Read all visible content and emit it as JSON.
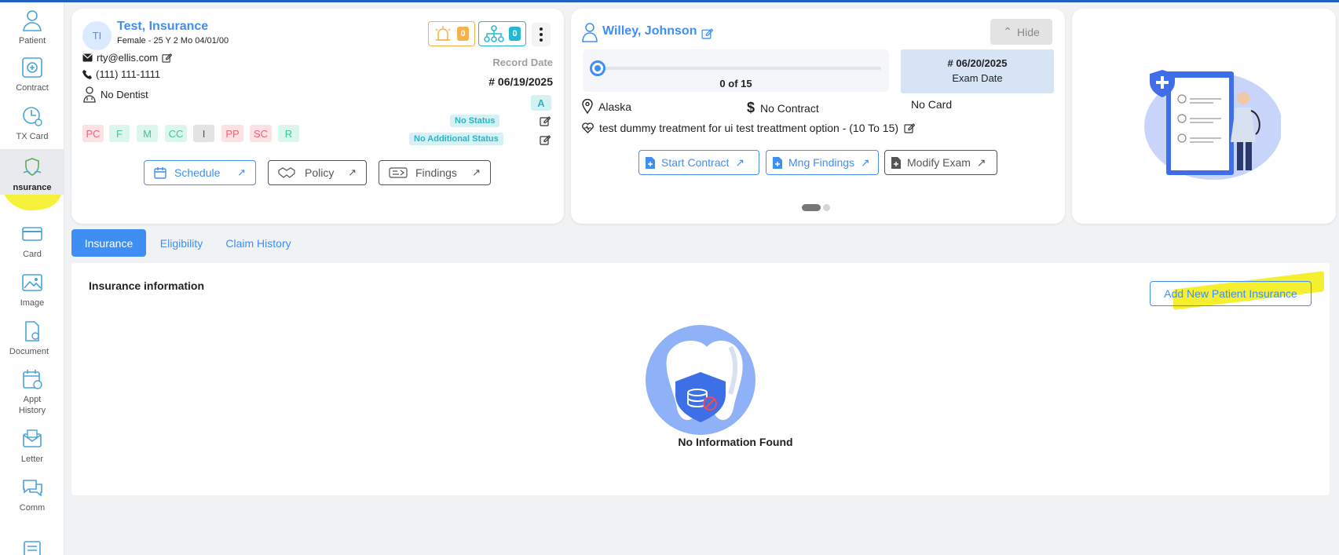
{
  "sidebar": {
    "items": [
      {
        "label": "Patient",
        "icon": "patient-icon"
      },
      {
        "label": "Contract",
        "icon": "contract-icon"
      },
      {
        "label": "TX Card",
        "icon": "tx-card-icon"
      },
      {
        "label": "nsurance",
        "icon": "insurance-icon"
      },
      {
        "label": "Card",
        "icon": "card-icon"
      },
      {
        "label": "Image",
        "icon": "image-icon"
      },
      {
        "label": "Document",
        "icon": "document-icon"
      },
      {
        "label": "Appt History",
        "icon": "appt-history-icon"
      },
      {
        "label": "Letter",
        "icon": "letter-icon"
      },
      {
        "label": "Comm",
        "icon": "comm-icon"
      }
    ],
    "active": "Insurance"
  },
  "patient": {
    "initials": "TI",
    "name": "Test, Insurance",
    "meta": "Female - 25 Y 2 Mo 04/01/00",
    "email": "rty@ellis.com",
    "phone": "(111) 111-1111",
    "dentist": "No Dentist",
    "alerts_count": "0",
    "tree_count": "0",
    "record_date_label": "Record Date",
    "record_date": "# 06/19/2025",
    "status_letter": "A",
    "status": "No Status",
    "additional_status": "No Additional Status",
    "tags": [
      "PC",
      "F",
      "M",
      "CC",
      "I",
      "PP",
      "SC",
      "R"
    ],
    "buttons": {
      "schedule": "Schedule",
      "policy": "Policy",
      "findings": "Findings"
    }
  },
  "treatment": {
    "doctor": "Willey, Johnson",
    "hide_label": "Hide",
    "progress_text": "0 of 15",
    "progress_fraction": 0.0,
    "exam_date": "# 06/20/2025",
    "exam_label": "Exam Date",
    "location": "Alaska",
    "contract": "No Contract",
    "card": "No Card",
    "treatment_desc": "test dummy treatment for ui test treattment option - (10 To 15)",
    "buttons": {
      "start_contract": "Start Contract",
      "mng_findings": "Mng Findings",
      "modify_exam": "Modify Exam"
    }
  },
  "tabs": [
    "Insurance",
    "Eligibility",
    "Claim History"
  ],
  "active_tab": "Insurance",
  "insurance_panel": {
    "title": "Insurance information",
    "add_button": "Add New Patient Insurance",
    "empty_text": "No Information Found"
  },
  "colors": {
    "accent": "#3f8ef4",
    "highlight": "#f4ef2f",
    "topbar": "#1f5fbf"
  }
}
